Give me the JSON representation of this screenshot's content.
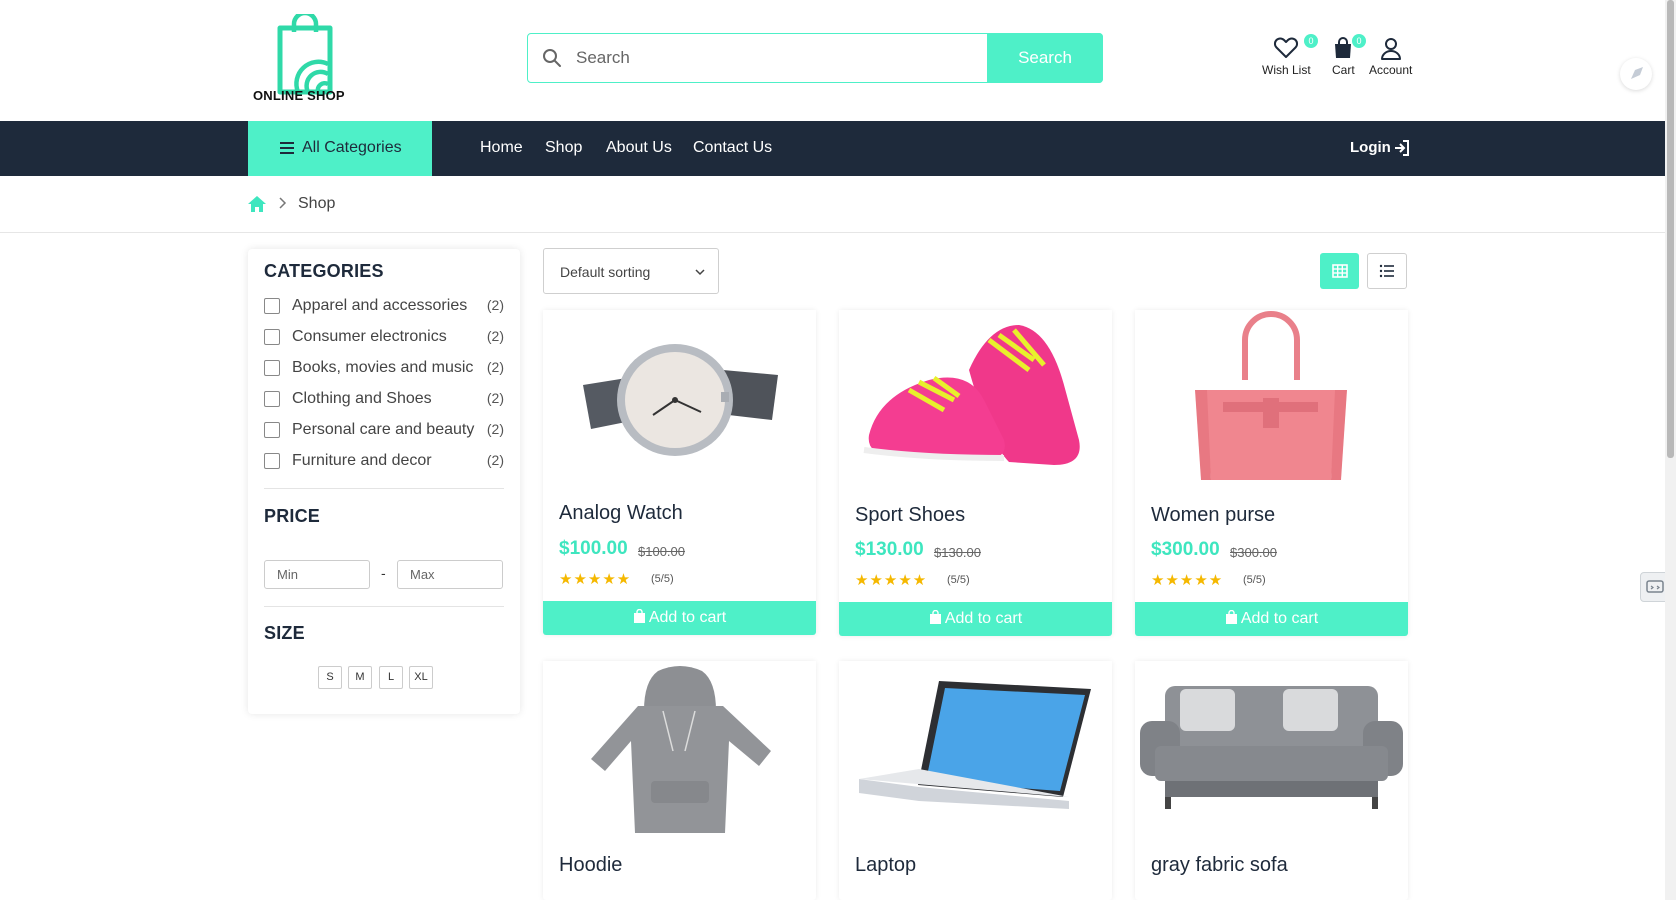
{
  "brand": {
    "name": "ONLINE SHOP",
    "accent": "#4ef0c8",
    "navy": "#1e2a3b"
  },
  "search": {
    "placeholder": "Search",
    "button": "Search"
  },
  "header_icons": [
    {
      "label": "Wish List",
      "badge": "0",
      "icon": "heart-icon"
    },
    {
      "label": "Cart",
      "badge": "0",
      "icon": "cart-icon"
    },
    {
      "label": "Account",
      "icon": "user-icon"
    }
  ],
  "nav": {
    "all_categories": "All Categories",
    "links": [
      "Home",
      "Shop",
      "About Us",
      "Contact Us"
    ],
    "login": "Login"
  },
  "breadcrumb": {
    "current": "Shop"
  },
  "sidebar": {
    "categories_title": "CATEGORIES",
    "categories": [
      {
        "label": "Apparel and accessories",
        "count": "(2)"
      },
      {
        "label": "Consumer electronics",
        "count": "(2)"
      },
      {
        "label": "Books, movies and music",
        "count": "(2)"
      },
      {
        "label": "Clothing and Shoes",
        "count": "(2)"
      },
      {
        "label": "Personal care and beauty",
        "count": "(2)"
      },
      {
        "label": "Furniture and decor",
        "count": "(2)"
      }
    ],
    "price_title": "PRICE",
    "price_min_placeholder": "Min",
    "price_max_placeholder": "Max",
    "price_dash": "-",
    "size_title": "SIZE",
    "sizes": [
      "S",
      "M",
      "L",
      "XL"
    ]
  },
  "toolbar": {
    "sorting": "Default sorting"
  },
  "products": [
    {
      "name": "Analog Watch",
      "price": "$100.00",
      "old_price": "$100.00",
      "stars": "★★★★★",
      "rating": "(5/5)",
      "cart": "Add to cart"
    },
    {
      "name": "Sport Shoes",
      "price": "$130.00",
      "old_price": "$130.00",
      "stars": "★★★★★",
      "rating": "(5/5)",
      "cart": "Add to cart"
    },
    {
      "name": "Women purse",
      "price": "$300.00",
      "old_price": "$300.00",
      "stars": "★★★★★",
      "rating": "(5/5)",
      "cart": "Add to cart"
    },
    {
      "name": "Hoodie"
    },
    {
      "name": "Laptop"
    },
    {
      "name": "gray fabric sofa"
    }
  ]
}
